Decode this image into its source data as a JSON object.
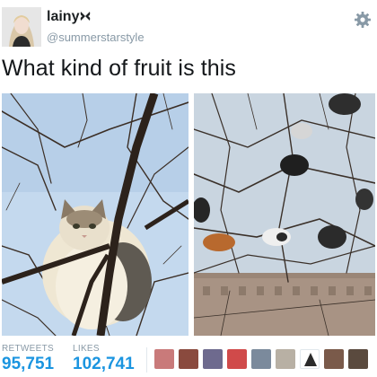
{
  "author": {
    "display_name": "lainy",
    "badge_icon": "butterfly-icon",
    "handle": "@summerstarstyle"
  },
  "settings_icon": "gear-icon",
  "tweet": {
    "text": "What kind of fruit is this"
  },
  "media": [
    {
      "name": "photo-cat-in-tree",
      "description_icon": "photo"
    },
    {
      "name": "photo-cats-in-tree",
      "description_icon": "photo"
    }
  ],
  "stats": {
    "retweets_label": "RETWEETS",
    "retweets_value": "95,751",
    "likes_label": "LIKES",
    "likes_value": "102,741"
  },
  "liker_avatars": 9,
  "colors": {
    "accent": "#1b95e0",
    "muted": "#8899a6",
    "sky": "#c9dcef"
  }
}
